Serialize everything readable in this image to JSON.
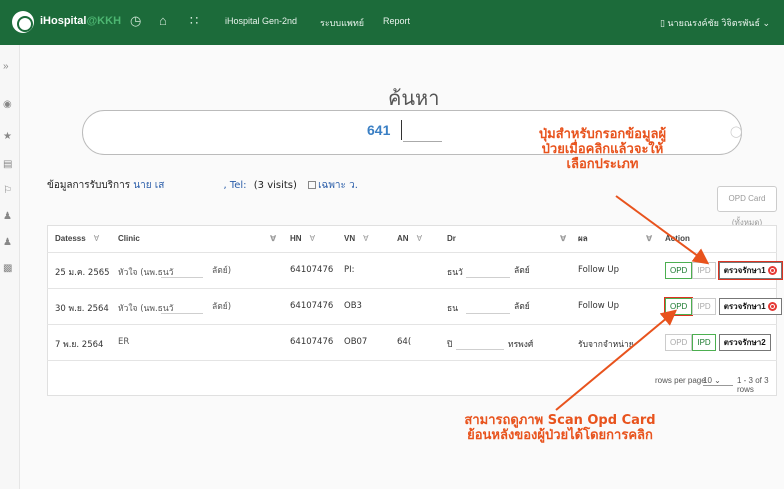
{
  "header": {
    "brand_main": "iHospital",
    "brand_accent": "@KKH",
    "nav_items": [
      "iHospital Gen-2nd",
      "ระบบแพทย์",
      "Report"
    ],
    "user": "นายณรงค์ชัย วิจิตรพันธ์"
  },
  "icons": {
    "top": [
      "dashboard-icon",
      "home-icon",
      "apps-grid-icon"
    ],
    "sidebar": [
      "expand-icon",
      "patient-icon",
      "person-icon",
      "records-icon",
      "flag-icon",
      "group-icon",
      "user-icon",
      "report-icon"
    ]
  },
  "search": {
    "title": "ค้นหา",
    "value": "641"
  },
  "service_info": {
    "label": "ข้อมูลการรับบริการ",
    "patient_prefix": "นาย เส",
    "tel_label": ", Tel:",
    "visits": "(3 visits)",
    "filter_label": "เฉพาะ ว."
  },
  "opd_card_button": "OPD Card (ทั้งหมด)",
  "table": {
    "columns": [
      "Datesss",
      "Clinic",
      "HN",
      "VN",
      "AN",
      "Dr",
      "ผล",
      "Action"
    ],
    "rows": [
      {
        "date": "25 ม.ค. 2565",
        "clinic": "หัวใจ (นพ.ธนวั",
        "clinic_tail": "ลัตย์)",
        "hn": "64107476",
        "vn": "PI:",
        "an": "",
        "dr": "ธนวั",
        "dr_tail": "ลัตย์",
        "result": "Follow Up",
        "opd": "OPD",
        "ipd": "IPD",
        "treat": "ตรวจรักษา1",
        "opd_active": true,
        "ipd_active": false
      },
      {
        "date": "30 พ.ย. 2564",
        "clinic": "หัวใจ (นพ.ธนวั",
        "clinic_tail": "ลัตย์)",
        "hn": "64107476",
        "vn": "OB3",
        "an": "",
        "dr": "ธน",
        "dr_tail": "ลัตย์",
        "result": "Follow Up",
        "opd": "OPD",
        "ipd": "IPD",
        "treat": "ตรวจรักษา1",
        "opd_active": true,
        "ipd_active": false
      },
      {
        "date": "7 พ.ย. 2564",
        "clinic": "ER",
        "clinic_tail": "",
        "hn": "64107476",
        "vn": "OB07",
        "an": "64(",
        "dr": "ปิ",
        "dr_tail": "ทรพงศ์",
        "result": "รับจากจำหน่าย",
        "opd": "OPD",
        "ipd": "IPD",
        "treat": "ตรวจรักษา2",
        "opd_active": false,
        "ipd_active": true
      }
    ],
    "footer": {
      "rows_label": "rows per page",
      "rows_value": "10",
      "range": "1 - 3 of 3 rows"
    }
  },
  "annotations": {
    "top": [
      "ปุ่มสำหรับกรอกข้อมูลผู้",
      "ป่วยเมื่อคลิกแล้วจะให้",
      "เลือกประเภท"
    ],
    "bottom": [
      "สามารถดูภาพ Scan Opd Card",
      "ย้อนหลังของผู้ป่วยได้โดยการคลิก"
    ]
  },
  "colors": {
    "topbar": "#1c6b3a",
    "accent_green": "#4caf50",
    "annotation": "#e8531d",
    "link_blue": "#2b5ea9",
    "alert_red": "#e53935"
  }
}
